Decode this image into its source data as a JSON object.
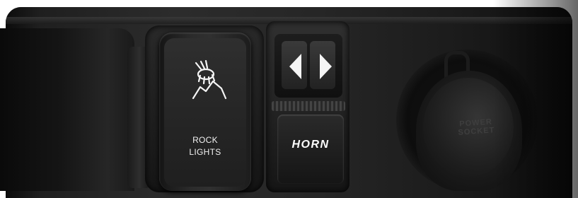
{
  "photo": {
    "subject": "vehicle-dashboard-switch-panel",
    "rock_switch": {
      "label_line1": "ROCK",
      "label_line2": "LIGHTS",
      "icon": "rock-lights-icon"
    },
    "horn_switch": {
      "label": "HORN",
      "arrow_left_icon": "arrow-left-icon",
      "arrow_right_icon": "arrow-right-icon"
    },
    "power_socket": {
      "cap_line1": "POWER",
      "cap_line2": "SOCKET"
    },
    "colors": {
      "label_text": "#f2f2f2",
      "panel_dark": "#1b1b1b"
    }
  }
}
